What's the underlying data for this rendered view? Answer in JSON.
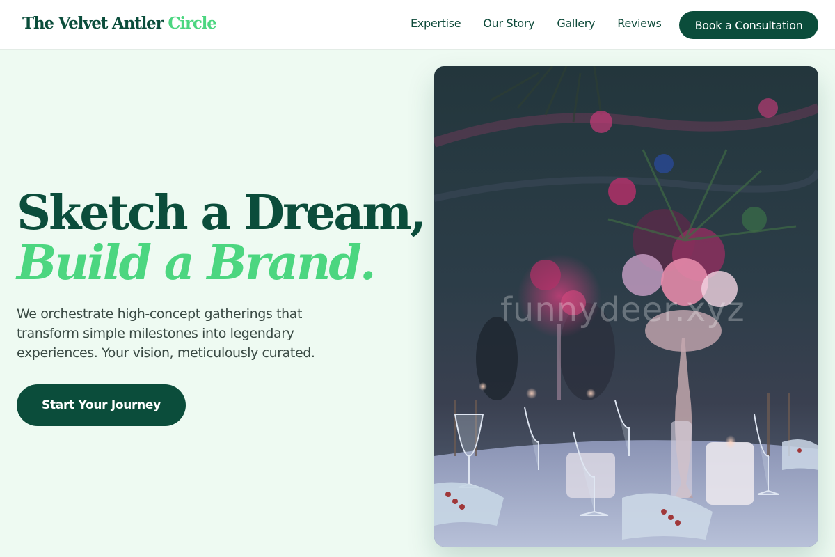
{
  "brand": {
    "name": "The Velvet Antler",
    "accent": "Circle"
  },
  "nav": {
    "items": [
      "Expertise",
      "Our Story",
      "Gallery",
      "Reviews"
    ],
    "cta_label": "Book a Consultation"
  },
  "hero": {
    "title_line1": "Sketch a Dream,",
    "title_line2": "Build a Brand.",
    "subtitle": "We orchestrate high-concept gatherings that transform simple milestones into legendary experiences. Your vision, meticulously curated.",
    "cta_label": "Start Your Journey"
  },
  "photo": {
    "watermark": "funnydeer.xyz"
  },
  "colors": {
    "primary": "#0b4d3b",
    "accent": "#4cd680",
    "background": "#eefaf2",
    "text": "#3a4a44"
  }
}
